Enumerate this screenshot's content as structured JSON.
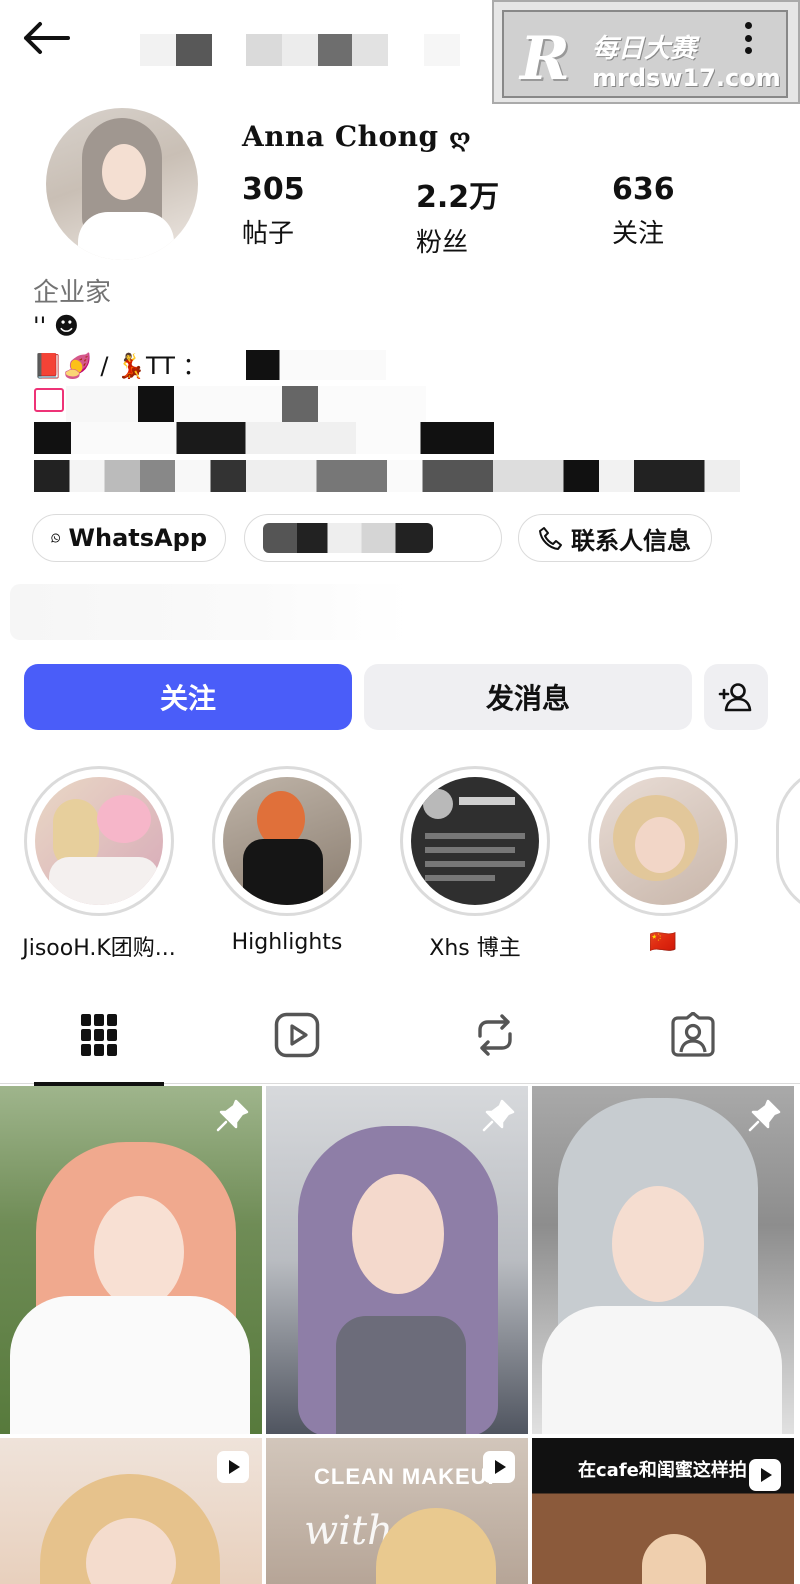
{
  "header": {
    "back_icon": "arrow-left-icon",
    "more_icon": "more-vertical-icon",
    "watermark": {
      "logo": "R",
      "title": "每日大赛",
      "url": "mrdsw17.com"
    }
  },
  "profile": {
    "display_name": "Anna Chong",
    "name_emoji": "ღ",
    "stats": [
      {
        "value": "305",
        "label": "帖子"
      },
      {
        "value": "2.2万",
        "label": "粉丝"
      },
      {
        "value": "636",
        "label": "关注"
      }
    ],
    "category": "企业家",
    "bio": {
      "line1": "'' ☻",
      "line2_prefix": "📕🍠 / 💃TT ："
    }
  },
  "contact_chips": {
    "whatsapp": {
      "icon": "whatsapp-icon",
      "label": "WhatsApp"
    },
    "contact_info": {
      "icon": "phone-icon",
      "label": "联系人信息"
    }
  },
  "actions": {
    "follow": "关注",
    "message": "发消息",
    "add_user_icon": "add-person-icon"
  },
  "highlights": [
    {
      "label": "JisooH.K团购..."
    },
    {
      "label": "Highlights"
    },
    {
      "label": "Xhs 博主"
    },
    {
      "label": "🇨🇳"
    }
  ],
  "tabs": [
    {
      "name": "posts",
      "icon": "grid-icon",
      "active": true
    },
    {
      "name": "reels",
      "icon": "reels-icon",
      "active": false
    },
    {
      "name": "reposts",
      "icon": "repost-icon",
      "active": false
    },
    {
      "name": "tagged",
      "icon": "tagged-person-icon",
      "active": false
    }
  ],
  "posts": [
    {
      "type": "pinned",
      "overlay_text": ""
    },
    {
      "type": "pinned",
      "overlay_text": ""
    },
    {
      "type": "pinned",
      "overlay_text": ""
    },
    {
      "type": "reel",
      "overlay_text": ""
    },
    {
      "type": "reel",
      "overlay_text": "CLEAN MAKEUP",
      "overlay_text_2": "with"
    },
    {
      "type": "reel",
      "overlay_text": "在cafe和闺蜜这样拍："
    }
  ],
  "colors": {
    "follow_button": "#4a5df9",
    "secondary_button": "#efeff2",
    "divider": "#dbdbdb",
    "category_text": "#737373"
  }
}
